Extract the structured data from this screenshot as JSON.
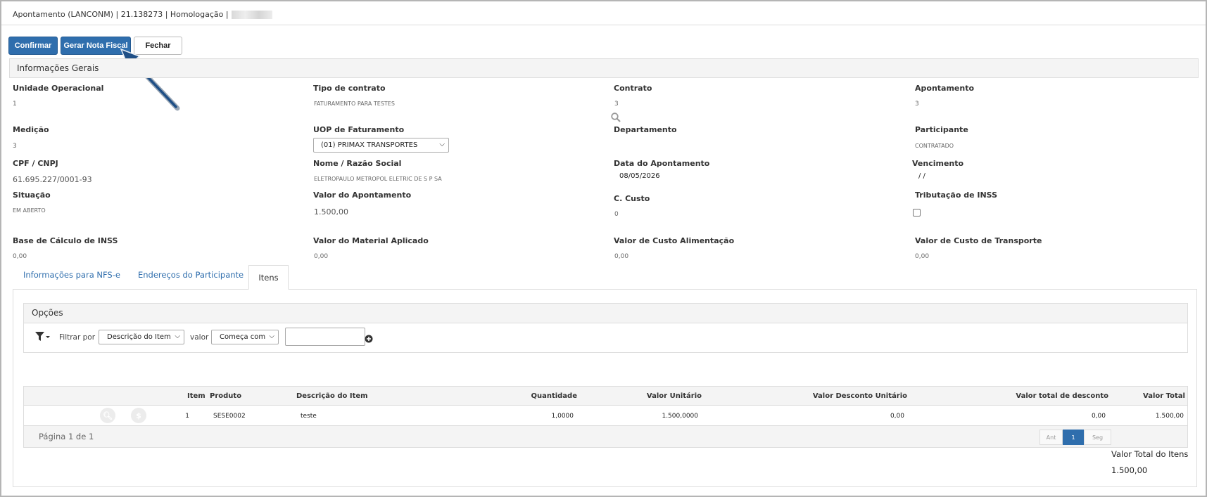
{
  "window": {
    "title": "Apontamento (LANCONM) | 21.138273 | Homologação |"
  },
  "toolbar": {
    "confirm_label": "Confirmar",
    "invoice_label": "Gerar Nota Fiscal",
    "close_label": "Fechar"
  },
  "general": {
    "section_title": "Informações Gerais",
    "unidade_operacional": {
      "label": "Unidade Operacional",
      "value": "1"
    },
    "tipo_contrato": {
      "label": "Tipo de contrato",
      "value": "FATURAMENTO PARA TESTES"
    },
    "contrato": {
      "label": "Contrato",
      "value": "3"
    },
    "apontamento": {
      "label": "Apontamento",
      "value": "3"
    },
    "medicao": {
      "label": "Medição",
      "value": "3"
    },
    "uop_faturamento": {
      "label": "UOP de Faturamento",
      "value": "(01) PRIMAX TRANSPORTES"
    },
    "departamento": {
      "label": "Departamento",
      "value": ""
    },
    "participante": {
      "label": "Participante",
      "value": "CONTRATADO"
    },
    "cpf_cnpj": {
      "label": "CPF / CNPJ",
      "value": "61.695.227/0001-93"
    },
    "nome_razao": {
      "label": "Nome / Razão Social",
      "value": "ELETROPAULO METROPOL ELETRIC DE S P SA"
    },
    "data_apontamento": {
      "label": "Data do Apontamento",
      "value": "08/05/2026"
    },
    "vencimento": {
      "label": "Vencimento",
      "value": "/ /"
    },
    "situacao": {
      "label": "Situação",
      "value": "EM ABERTO"
    },
    "valor_apontamento": {
      "label": "Valor do Apontamento",
      "value": "1.500,00"
    },
    "c_custo": {
      "label": "C. Custo",
      "value": "0"
    },
    "tributacao_inss": {
      "label": "Tributação de INSS",
      "checked": false
    },
    "base_inss": {
      "label": "Base de Cálculo de INSS",
      "value": "0,00"
    },
    "valor_material": {
      "label": "Valor do Material Aplicado",
      "value": "0,00"
    },
    "valor_alimentacao": {
      "label": "Valor de Custo Alimentação",
      "value": "0,00"
    },
    "valor_transporte": {
      "label": "Valor de Custo de Transporte",
      "value": "0,00"
    }
  },
  "tabs": [
    {
      "label": "Informações para NFS-e",
      "active": false
    },
    {
      "label": "Endereços do Participante",
      "active": false
    },
    {
      "label": "Itens",
      "active": true
    }
  ],
  "options": {
    "title": "Opções",
    "filter_by_label": "Filtrar por",
    "filter_field": "Descrição do Item",
    "value_label": "valor",
    "operator": "Começa com",
    "value_input": ""
  },
  "grid": {
    "columns": [
      "Item",
      "Produto",
      "Descrição do Item",
      "Quantidade",
      "Valor Unitário",
      "Valor Desconto Unitário",
      "Valor total de desconto",
      "Valor Total"
    ],
    "rows": [
      {
        "item": "1",
        "produto": "SESE0002",
        "descricao": "teste",
        "quantidade": "1,0000",
        "valor_unitario": "1.500,0000",
        "desconto_unitario": "0,00",
        "total_desconto": "0,00",
        "valor_total": "1.500,00"
      }
    ],
    "page_info": "Página 1 de 1",
    "prev_label": "Ant",
    "current_page": "1",
    "next_label": "Seg"
  },
  "totals": {
    "label": "Valor Total do Itens",
    "value": "1.500,00"
  },
  "colors": {
    "primary": "#2f6ead",
    "link": "#2f6ead",
    "panel_bg": "#f4f4f4",
    "border": "#dddddd"
  }
}
